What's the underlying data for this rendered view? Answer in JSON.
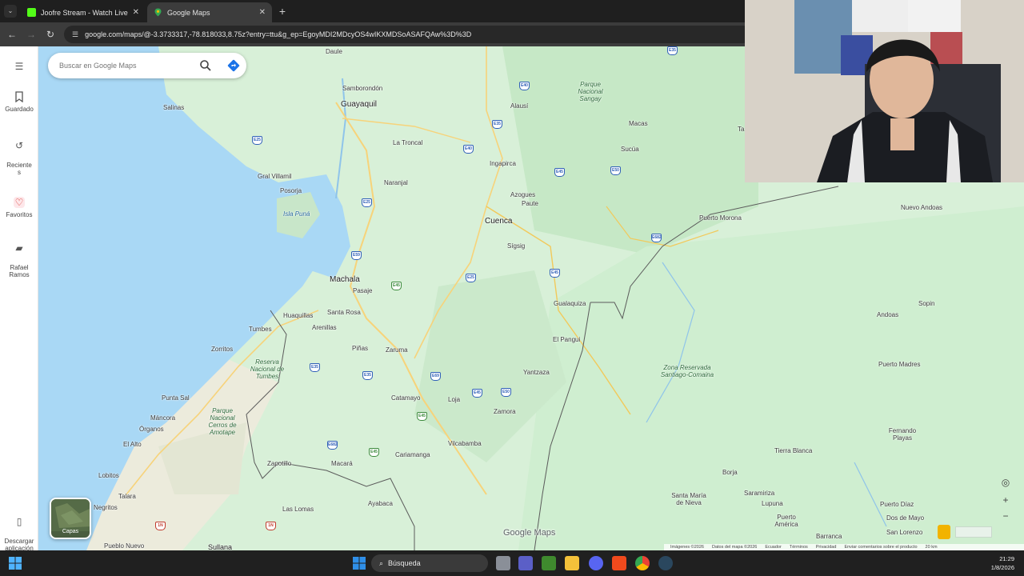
{
  "browser": {
    "tabs": [
      {
        "title": "Joofre Stream - Watch Live on",
        "favicon": "kick-icon",
        "active": false
      },
      {
        "title": "Google Maps",
        "favicon": "maps-pin-icon",
        "active": true
      }
    ],
    "url": "google.com/maps/@-3.3733317,-78.818033,8.75z?entry=ttu&g_ep=EgoyMDI2MDcyOS4wIKXMDSoASAFQAw%3D%3D"
  },
  "rail": {
    "menu_icon": "hamburger-icon",
    "items": [
      {
        "label": "Guardado",
        "icon": "bookmark-icon"
      },
      {
        "label": "Reciente\ns",
        "icon": "history-icon"
      },
      {
        "label": "Favoritos",
        "icon": "heart-icon"
      },
      {
        "label": "Rafael\nRamos",
        "icon": "car-icon"
      },
      {
        "label": "Descargar\naplicación",
        "icon": "phone-icon"
      }
    ]
  },
  "search": {
    "placeholder": "Buscar en Google Maps"
  },
  "layers": {
    "label": "Capas"
  },
  "map": {
    "cities": [
      "Guayaquil",
      "Cuenca",
      "Machala"
    ],
    "places": [
      "Daule",
      "Samborondón",
      "Alausí",
      "Parque Nacional Sangay",
      "Salinas",
      "Macas",
      "Sucúa",
      "La Troncal",
      "Ingapirca",
      "Gral Villamil",
      "Naranjal",
      "Posorja",
      "Azogues",
      "Paute",
      "Isla Puná",
      "Sígsig",
      "Puerto Morona",
      "Nuevo Andoas",
      "Pasaje",
      "Gualaquiza",
      "Huaquillas",
      "Santa Rosa",
      "Arenillas",
      "Tumbes",
      "Zorritos",
      "Piñas",
      "Zaruma",
      "El Pangui",
      "Reserva Nacional de Tumbes",
      "Yantzaza",
      "Zona Reservada Santiago-Comaina",
      "Andoas",
      "Sopin",
      "Puerto Madres",
      "Punta Sal",
      "Catamayo",
      "Loja",
      "Zamora",
      "Máncora",
      "Parque Nacional Cerros de Amotape",
      "Órganos",
      "Vilcabamba",
      "El Alto",
      "Fernando Playas",
      "Zapotillo",
      "Macará",
      "Cariamanga",
      "Tierra Blanca",
      "Borja",
      "Lobitos",
      "Talara",
      "Negritos",
      "Las Lomas",
      "Ayabaca",
      "Santa María de Nieva",
      "Saramiriza",
      "Lupuna",
      "Puerto Díaz",
      "Puerto América",
      "Dos de Mayo",
      "San Lorenzo",
      "Barranca",
      "Pueblo Nuevo",
      "Sullana",
      "Ta"
    ],
    "route_shields": [
      "E25",
      "E40",
      "E35",
      "E25",
      "E40",
      "E59",
      "E45",
      "E50",
      "E45",
      "E25",
      "E35",
      "E35",
      "E69",
      "E45",
      "E50",
      "E682",
      "E682",
      "E45",
      "E45",
      "E45",
      "1N",
      "1N",
      "E35"
    ],
    "watermark": "Google Maps",
    "footer": [
      "Imágenes ©2026",
      "Datos del mapa ©2026",
      "Ecuador",
      "Términos",
      "Privacidad",
      "Enviar comentarios sobre el producto",
      "20 km"
    ]
  },
  "taskbar": {
    "search_label": "Búsqueda",
    "time": "21:29",
    "date": "1/8/2026"
  },
  "colors": {
    "land": "#d8f0d8",
    "forest": "#c3e6c4",
    "dry": "#ecebdc",
    "water": "#a9d8f5",
    "road": "#f7d37a",
    "border": "#5b5b5b",
    "accent": "#1a73e8"
  }
}
